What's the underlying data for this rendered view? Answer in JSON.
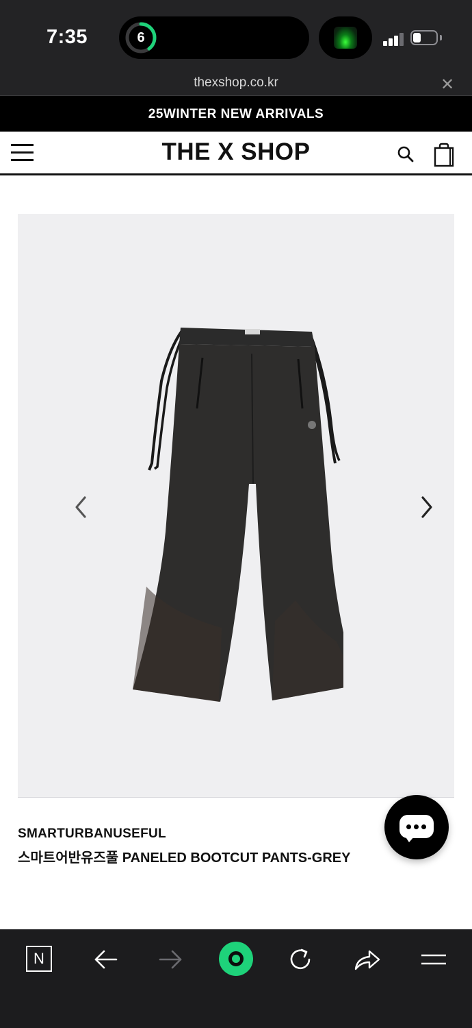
{
  "status_bar": {
    "time": "7:35",
    "activity_count": "6",
    "activity_ring_color": "#1ed27a",
    "icons": [
      "activity-ring-icon",
      "live-activity-thumb",
      "cellular-signal-icon",
      "battery-icon"
    ]
  },
  "browser": {
    "url": "thexshop.co.kr",
    "close_icon": "close-icon"
  },
  "promo_banner": {
    "text": "25WINTER NEW ARRIVALS"
  },
  "site_header": {
    "logo": "THE X SHOP",
    "menu_icon": "hamburger-menu-icon",
    "search_icon": "search-icon",
    "cart_icon": "shopping-bag-icon"
  },
  "product": {
    "image_icon": "pants-product-image",
    "prev_icon": "chevron-left-icon",
    "next_icon": "chevron-right-icon",
    "brand": "SMARTURBANUSEFUL",
    "name": "스마트어반유즈풀 PANELED BOOTCUT PANTS-GREY"
  },
  "chat": {
    "icon": "chat-bubble-icon"
  },
  "toolbar": {
    "tab_letter": "N",
    "items": [
      "tabs-n-icon",
      "back-arrow-icon",
      "forward-arrow-icon",
      "home-circle-icon",
      "reload-icon",
      "share-icon",
      "menu-lines-icon"
    ],
    "accent": "#1ed27a"
  }
}
